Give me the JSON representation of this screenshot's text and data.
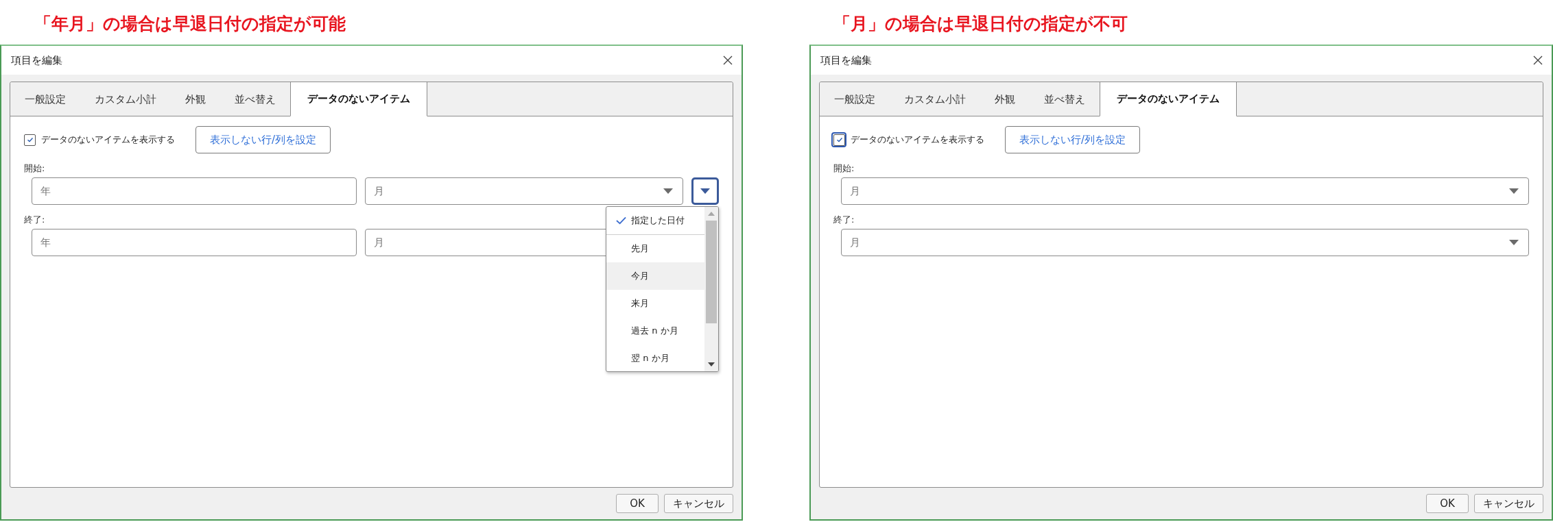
{
  "panels": [
    {
      "caption": "「年月」の場合は早退日付の指定が可能",
      "dialog": {
        "title": "項目を編集",
        "tabs": [
          {
            "label": "一般設定",
            "selected": false
          },
          {
            "label": "カスタム小計",
            "selected": false
          },
          {
            "label": "外観",
            "selected": false
          },
          {
            "label": "並べ替え",
            "selected": false
          },
          {
            "label": "データのないアイテム",
            "selected": true
          }
        ],
        "show_empty": {
          "label": "データのないアイテムを表示する",
          "checked": true,
          "focused": false
        },
        "set_button": "表示しない行/列を設定",
        "ranges": [
          {
            "label": "開始:",
            "fields": [
              {
                "kind": "text",
                "placeholder": "年"
              },
              {
                "kind": "select",
                "value": "月"
              },
              {
                "kind": "menu-button",
                "focused": true
              }
            ],
            "menu": {
              "items": [
                {
                  "label": "指定した日付",
                  "checked": true,
                  "highlighted": false
                },
                {
                  "label": "先月",
                  "checked": false,
                  "highlighted": false
                },
                {
                  "label": "今月",
                  "checked": false,
                  "highlighted": true
                },
                {
                  "label": "来月",
                  "checked": false,
                  "highlighted": false
                },
                {
                  "label": "過去 n か月",
                  "checked": false,
                  "highlighted": false
                },
                {
                  "label": "翌 n か月",
                  "checked": false,
                  "highlighted": false
                }
              ]
            }
          },
          {
            "label": "終了:",
            "fields": [
              {
                "kind": "text",
                "placeholder": "年"
              },
              {
                "kind": "select",
                "value": "月"
              }
            ]
          }
        ],
        "buttons": [
          "OK",
          "キャンセル"
        ]
      }
    },
    {
      "caption": "「月」の場合は早退日付の指定が不可",
      "dialog": {
        "title": "項目を編集",
        "tabs": [
          {
            "label": "一般設定",
            "selected": false
          },
          {
            "label": "カスタム小計",
            "selected": false
          },
          {
            "label": "外観",
            "selected": false
          },
          {
            "label": "並べ替え",
            "selected": false
          },
          {
            "label": "データのないアイテム",
            "selected": true
          }
        ],
        "show_empty": {
          "label": "データのないアイテムを表示する",
          "checked": true,
          "focused": true
        },
        "set_button": "表示しない行/列を設定",
        "ranges": [
          {
            "label": "開始:",
            "fields": [
              {
                "kind": "select",
                "value": "月"
              }
            ]
          },
          {
            "label": "終了:",
            "fields": [
              {
                "kind": "select",
                "value": "月"
              }
            ]
          }
        ],
        "buttons": [
          "OK",
          "キャンセル"
        ]
      }
    }
  ]
}
